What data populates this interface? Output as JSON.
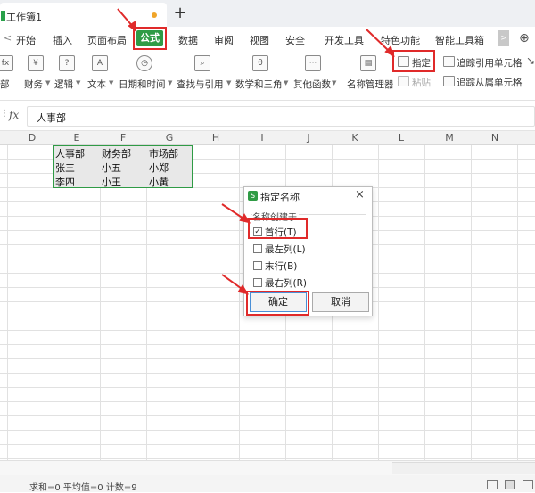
{
  "titlebar": {
    "doc_title": "工作簿1",
    "new_tab": "+"
  },
  "menu": {
    "back": "<",
    "tabs": [
      "开始",
      "插入",
      "页面布局",
      "公式",
      "数据",
      "审阅",
      "视图",
      "安全",
      "开发工具",
      "特色功能",
      "智能工具箱"
    ],
    "active_tab": "公式",
    "more": ">"
  },
  "ribbon": {
    "groups": [
      {
        "label": "部",
        "icon": "fx-icon"
      },
      {
        "label": "财务",
        "icon": "finance-icon"
      },
      {
        "label": "逻辑",
        "icon": "logic-icon"
      },
      {
        "label": "文本",
        "icon": "text-icon"
      },
      {
        "label": "日期和时间",
        "icon": "clock-icon"
      },
      {
        "label": "查找与引用",
        "icon": "lookup-icon"
      },
      {
        "label": "数学和三角",
        "icon": "math-icon"
      },
      {
        "label": "其他函数",
        "icon": "more-functions-icon"
      },
      {
        "label": "名称管理器",
        "icon": "name-manager-icon"
      }
    ],
    "designate": "指定",
    "paste": "粘贴",
    "trace_precedents": "追踪引用单元格",
    "trace_dependents": "追踪从属单元格"
  },
  "formula_bar": {
    "fx": "fx",
    "value": "人事部"
  },
  "columns": [
    "D",
    "E",
    "F",
    "G",
    "H",
    "I",
    "J",
    "K",
    "L",
    "M",
    "N"
  ],
  "table": [
    [
      "人事部",
      "财务部",
      "市场部"
    ],
    [
      "张三",
      "小五",
      "小郑"
    ],
    [
      "李四",
      "小王",
      "小黄"
    ]
  ],
  "dialog": {
    "title": "指定名称",
    "close": "×",
    "group_label": "名称创建于",
    "options": [
      {
        "label": "首行(T)",
        "checked": true
      },
      {
        "label": "最左列(L)",
        "checked": false
      },
      {
        "label": "末行(B)",
        "checked": false
      },
      {
        "label": "最右列(R)",
        "checked": false
      }
    ],
    "ok": "确定",
    "cancel": "取消"
  },
  "status": {
    "text": "求和=0  平均值=0  计数=9"
  },
  "colors": {
    "accent": "#2f9b45",
    "highlight": "#e02a2a"
  }
}
